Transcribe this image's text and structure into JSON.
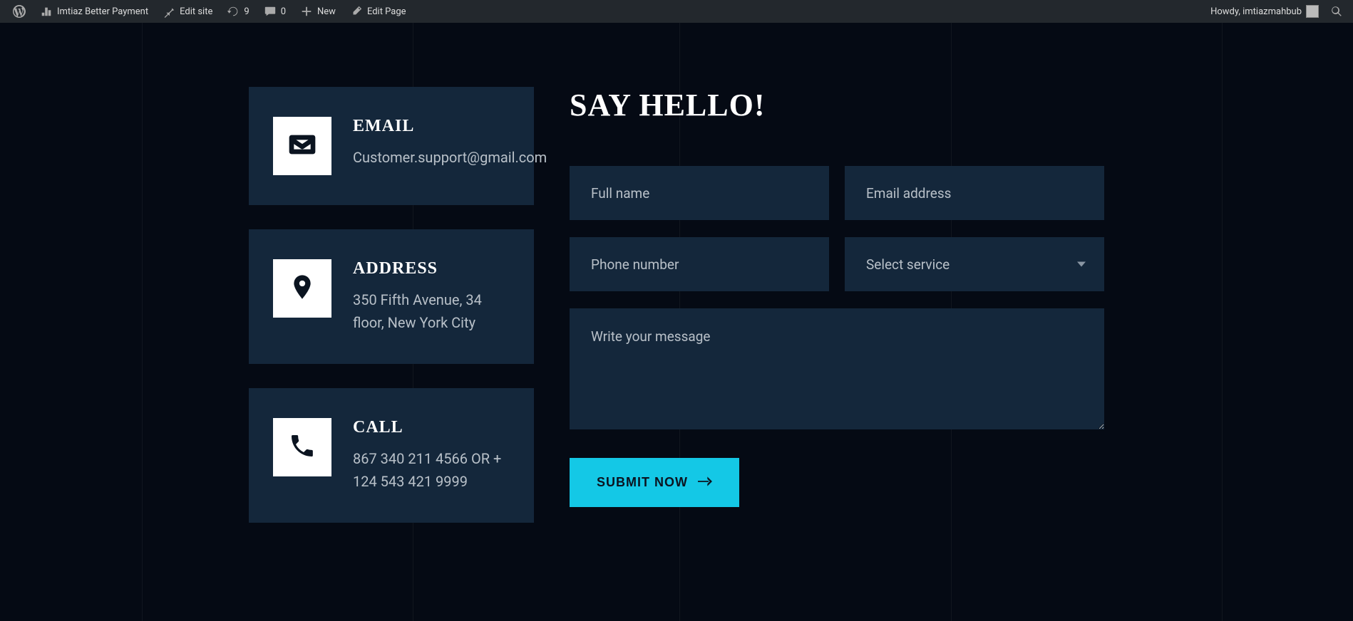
{
  "adminbar": {
    "site_name": "Imtiaz Better Payment",
    "edit_site": "Edit site",
    "updates_count": "9",
    "comments_count": "0",
    "new_label": "New",
    "edit_page": "Edit Page",
    "howdy": "Howdy, imtiazmahbub"
  },
  "contact_cards": [
    {
      "title": "EMAIL",
      "value": "Customer.support@gmail.com"
    },
    {
      "title": "ADDRESS",
      "value": "350 Fifth Avenue, 34 floor, New York City"
    },
    {
      "title": "CALL",
      "value": "867 340 211 4566 OR + 124 543 421 9999"
    }
  ],
  "form": {
    "heading": "SAY HELLO!",
    "fullname_placeholder": "Full name",
    "email_placeholder": "Email address",
    "phone_placeholder": "Phone number",
    "service_placeholder": "Select service",
    "message_placeholder": "Write your message",
    "submit_label": "SUBMIT NOW"
  },
  "colors": {
    "accent": "#14c8e6",
    "card_bg": "#14273b",
    "page_bg": "#050a14"
  }
}
